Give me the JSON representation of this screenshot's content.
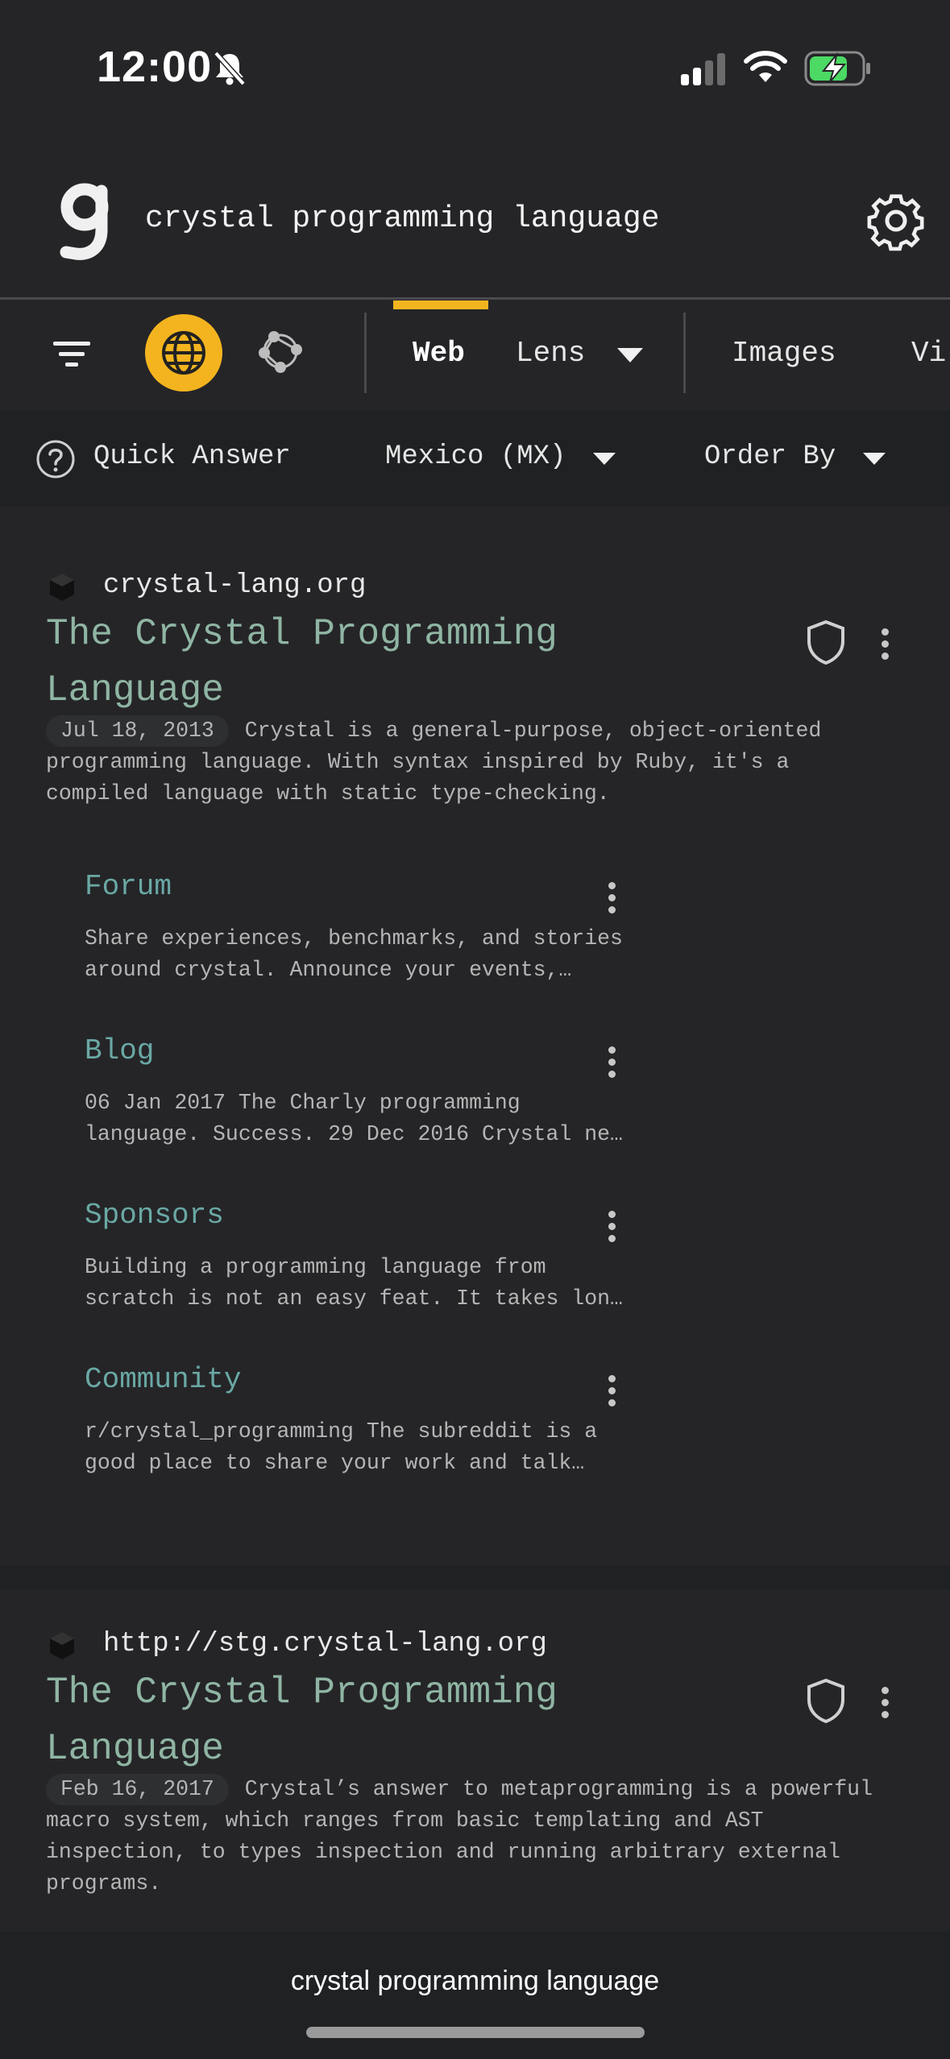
{
  "status": {
    "time": "12:00"
  },
  "search": {
    "query": "crystal programming language"
  },
  "tabs": [
    {
      "label": "Web",
      "active": true
    },
    {
      "label": "Lens"
    },
    {
      "label": "Images"
    },
    {
      "label": "Vi"
    }
  ],
  "filters": {
    "quick_answer": "Quick Answer",
    "region": "Mexico (MX)",
    "order_by": "Order By"
  },
  "results": [
    {
      "domain": "crystal-lang.org",
      "title_line1": "The Crystal Programming",
      "title_line2": "Language",
      "date": "Jul 18, 2013",
      "snippet_line1": "Crystal is a general-purpose, object-oriented",
      "snippet_line2": "programming language. With syntax inspired by Ruby, it's a",
      "snippet_line3": "compiled language with static type-checking.",
      "sublinks": [
        {
          "title": "Forum",
          "line1": "Share experiences, benchmarks, and stories",
          "line2": "around crystal. Announce your events,…"
        },
        {
          "title": "Blog",
          "line1": "06 Jan 2017 The Charly programming",
          "line2": "language. Success. 29 Dec 2016 Crystal ne…"
        },
        {
          "title": "Sponsors",
          "line1": "Building a programming language from",
          "line2": "scratch is not an easy feat. It takes lon…"
        },
        {
          "title": "Community",
          "line1": "r/crystal_programming The subreddit is a",
          "line2": "good place to share your work and talk…"
        }
      ]
    },
    {
      "domain": "http://stg.crystal-lang.org",
      "title_line1": "The Crystal Programming",
      "title_line2": "Language",
      "date": "Feb 16, 2017",
      "snippet_line1": "Crystal’s answer to metaprogramming is a powerful",
      "snippet_line2": "macro system, which ranges from basic templating and AST",
      "snippet_line3": "inspection, to types inspection and running arbitrary external",
      "snippet_line4": "programs."
    }
  ],
  "bottom": {
    "query": "crystal programming language"
  },
  "colors": {
    "accent": "#f4b41f",
    "background": "#252528",
    "title": "#8fb5a3",
    "sublink": "#6aa8a4"
  },
  "icons": [
    "bell-slash-icon",
    "signal-icon",
    "wifi-icon",
    "battery-charging-icon",
    "logo-g-icon",
    "gear-icon",
    "filter-icon",
    "globe-icon",
    "graph-icon",
    "question-icon",
    "shield-icon",
    "kebab-icon"
  ]
}
